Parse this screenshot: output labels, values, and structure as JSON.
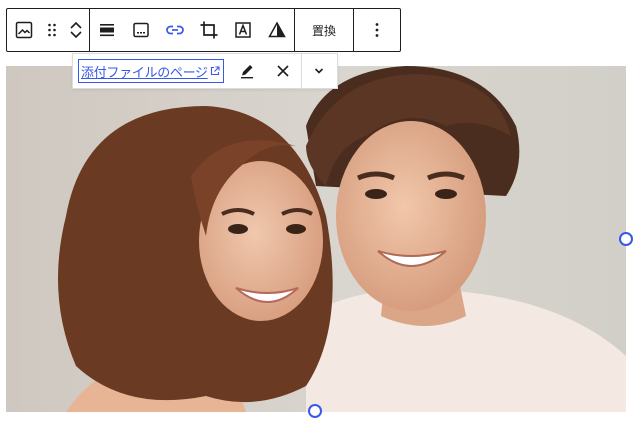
{
  "toolbar": {
    "icons": [
      "image-icon",
      "drag-handle-icon",
      "move-up-icon",
      "move-down-icon",
      "align-icon",
      "caption-icon",
      "link-icon",
      "crop-icon",
      "text-overlay-icon",
      "duotone-icon",
      "options-icon"
    ],
    "replace_label": "置換"
  },
  "link_popover": {
    "link_text": "添付ファイルのページ"
  },
  "colors": {
    "accent": "#3858e9",
    "border": "#1e1e1e"
  }
}
